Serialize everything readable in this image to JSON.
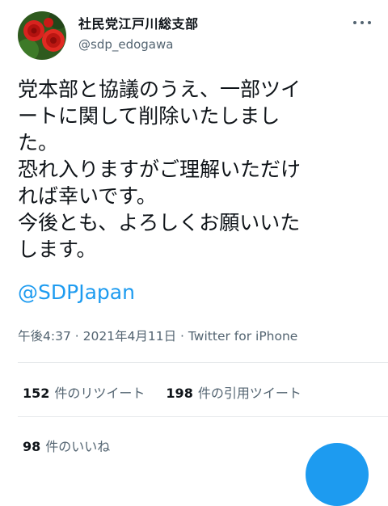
{
  "user": {
    "display_name": "社民党江戸川総支部",
    "handle": "@sdp_edogawa",
    "avatar_icon": "red-roses-avatar-icon"
  },
  "menu_icon": "more-horizontal-icon",
  "tweet": {
    "lines": [
      "党本部と協議のうえ、一部ツイ",
      "ートに関して削除いたしまし",
      "た。",
      "恐れ入りますがご理解いただけ",
      "れば幸いです。",
      "今後とも、よろしくお願いいた",
      "します。"
    ],
    "mention": "@SDPJapan",
    "time": "午後4:37",
    "sep1": " · ",
    "date": "2021年4月11日",
    "sep2": " · ",
    "source": "Twitter for iPhone"
  },
  "stats": {
    "retweets_count": "152",
    "retweets_label": "件のリツイート",
    "quotes_count": "198",
    "quotes_label": "件の引用ツイート",
    "likes_count": "98",
    "likes_label": "件のいいね"
  },
  "colors": {
    "accent": "#1d9bf0",
    "text": "#0f1419",
    "muted": "#536471"
  }
}
